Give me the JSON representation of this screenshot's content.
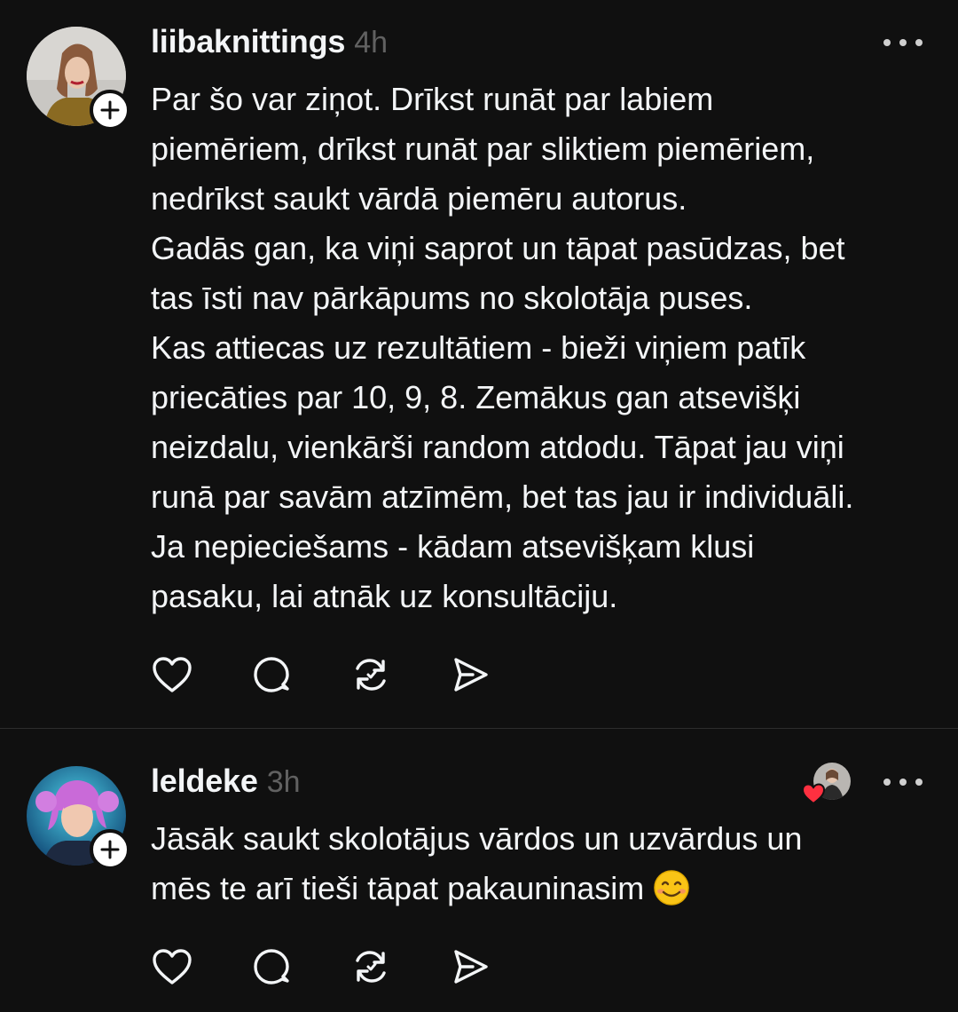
{
  "posts": [
    {
      "username": "liibaknittings",
      "timestamp": "4h",
      "lines": [
        "Par šo var ziņot. Drīkst runāt par labiem",
        "piemēriem, drīkst runāt par sliktiem piemēriem,",
        "nedrīkst saukt vārdā piemēru autorus.",
        "Gadās gan, ka viņi saprot un tāpat pasūdzas, bet",
        "tas īsti nav pārkāpums no skolotāja puses.",
        "Kas attiecas uz rezultātiem - bieži viņiem patīk",
        "priecāties par 10, 9, 8. Zemākus gan atsevišķi",
        "neizdalu, vienkārši random atdodu. Tāpat jau viņi",
        "runā par savām atzīmēm, bet tas jau ir individuāli.",
        "Ja nepieciešams - kādam atsevišķam klusi",
        "pasaku, lai atnāk uz konsultāciju."
      ]
    },
    {
      "username": "leldeke",
      "timestamp": "3h",
      "lines": [
        "Jāsāk saukt skolotājus vārdos un uzvārdus un",
        "mēs te arī tieši tāpat pakauninasim"
      ],
      "emoji": "smiling-face-emoji"
    }
  ],
  "icons": {
    "like": "heart-icon",
    "comment": "comment-bubble-icon",
    "repost": "repost-icon",
    "share": "send-icon",
    "more": "more-dots-icon",
    "follow": "plus-icon"
  },
  "colors": {
    "background": "#101010",
    "text": "#f3f5f7",
    "secondary": "#616161",
    "divider": "#2d2d2d",
    "heart": "#ff3040"
  }
}
